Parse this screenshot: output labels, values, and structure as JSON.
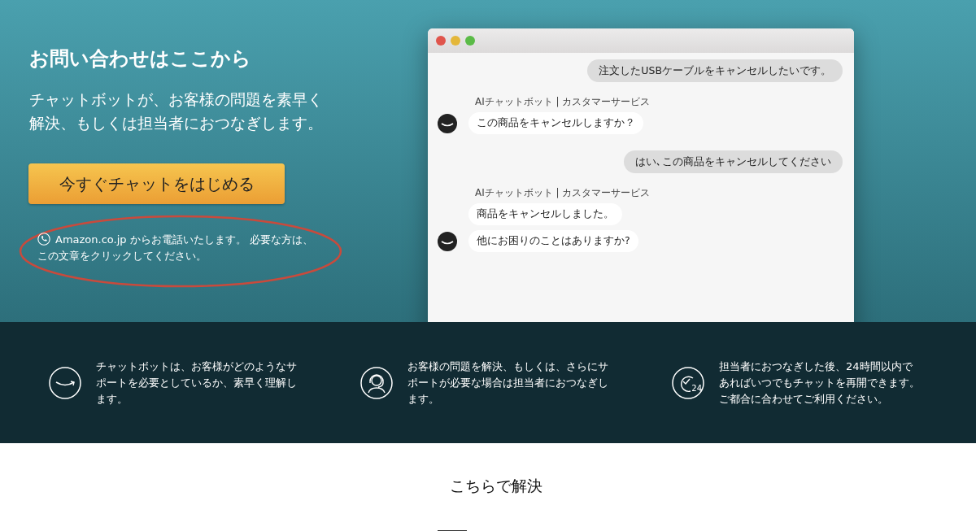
{
  "hero": {
    "title": "お問い合わせはここから",
    "description": "チャットボットが、お客様の問題を素早く解決、もしくは担当者におつなぎします。",
    "button": "今すぐチャットをはじめる",
    "phone_note": "Amazon.co.jp からお電話いたします。 必要な方は、この文章をクリックしてください。"
  },
  "chat": {
    "messages": [
      {
        "kind": "user",
        "text": "注文したUSBケーブルをキャンセルしたいです。"
      },
      {
        "kind": "bot",
        "sender": "AIチャットボット | カスタマーサービス",
        "bubbles": [
          "この商品をキャンセルしますか？"
        ]
      },
      {
        "kind": "user",
        "text": "はい､この商品をキャンセルしてください"
      },
      {
        "kind": "bot",
        "sender": "AIチャットボット | カスタマーサービス",
        "bubbles": [
          "商品をキャンセルしました。",
          "他にお困りのことはありますか?"
        ]
      }
    ]
  },
  "features": [
    {
      "kind": "smile",
      "text": "チャットボットは、お客様がどのようなサポートを必要としているか、素早く理解します。"
    },
    {
      "kind": "headset",
      "text": "お客様の問題を解決、もしくは、さらにサポートが必要な場合は担当者におつなぎします。"
    },
    {
      "kind": "clock",
      "icon_text": "24",
      "text": "担当者におつなぎした後、24時間以内であればいつでもチャットを再開できます。ご都合に合わせてご利用ください。"
    }
  ],
  "resolve": {
    "title": "こちらで解決"
  }
}
